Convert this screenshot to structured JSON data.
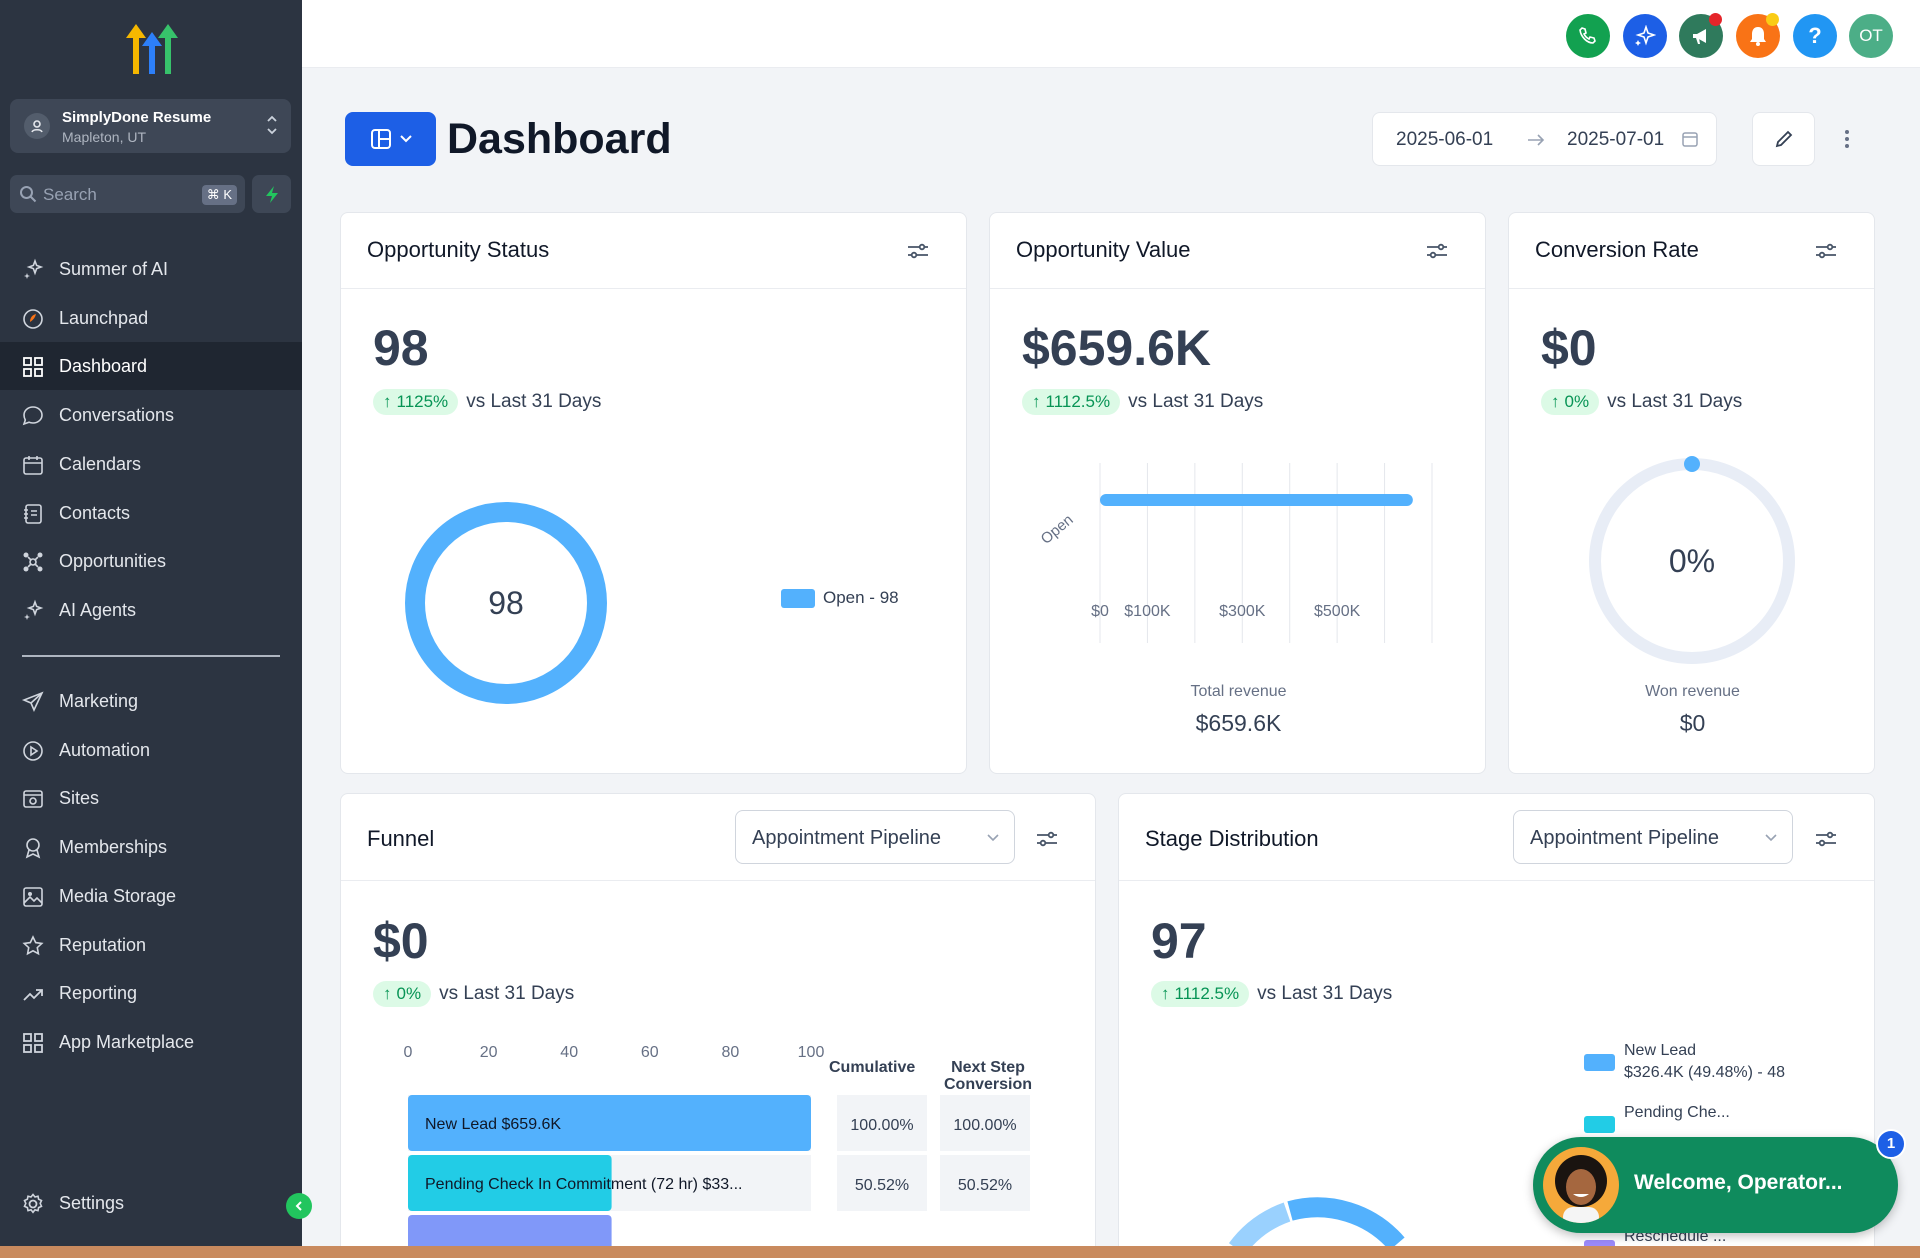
{
  "location": {
    "name": "SimplyDone Resume",
    "city": "Mapleton, UT"
  },
  "search": {
    "placeholder": "Search",
    "shortcut": "⌘ K"
  },
  "nav_top": [
    {
      "label": "Summer of AI",
      "icon": "sparkle-icon"
    },
    {
      "label": "Launchpad",
      "icon": "rocket-icon"
    },
    {
      "label": "Dashboard",
      "icon": "grid-icon",
      "active": true
    },
    {
      "label": "Conversations",
      "icon": "chat-bubble-icon"
    },
    {
      "label": "Calendars",
      "icon": "calendar-icon"
    },
    {
      "label": "Contacts",
      "icon": "contact-book-icon"
    },
    {
      "label": "Opportunities",
      "icon": "network-icon"
    },
    {
      "label": "AI Agents",
      "icon": "sparkle-icon"
    }
  ],
  "nav_bottom": [
    {
      "label": "Marketing",
      "icon": "send-icon"
    },
    {
      "label": "Automation",
      "icon": "play-circle-icon"
    },
    {
      "label": "Sites",
      "icon": "browser-icon"
    },
    {
      "label": "Memberships",
      "icon": "award-icon"
    },
    {
      "label": "Media Storage",
      "icon": "image-icon"
    },
    {
      "label": "Reputation",
      "icon": "star-icon"
    },
    {
      "label": "Reporting",
      "icon": "trend-up-icon"
    },
    {
      "label": "App Marketplace",
      "icon": "apps-icon"
    }
  ],
  "settings": {
    "label": "Settings"
  },
  "topbar": {
    "avatar_initials": "OT",
    "colors": {
      "phone": "#12a150",
      "ai": "#1d5fe6",
      "announce": "#2f7a5c",
      "bell": "#f97316",
      "help": "#2196f3",
      "avatar": "#4cae87"
    }
  },
  "header": {
    "title": "Dashboard",
    "date_start": "2025-06-01",
    "date_end": "2025-07-01"
  },
  "opportunity_status": {
    "title": "Opportunity Status",
    "value": "98",
    "change": "1125%",
    "vs": "vs Last 31 Days",
    "center": "98",
    "legend": "Open - 98"
  },
  "opportunity_value": {
    "title": "Opportunity Value",
    "value": "$659.6K",
    "change": "1112.5%",
    "vs": "vs Last 31 Days",
    "total_label": "Total revenue",
    "total_value": "$659.6K"
  },
  "conversion_rate": {
    "title": "Conversion Rate",
    "value": "$0",
    "change": "0%",
    "vs": "vs Last 31 Days",
    "center": "0%",
    "won_label": "Won revenue",
    "won_value": "$0"
  },
  "funnel": {
    "title": "Funnel",
    "pipeline": "Appointment Pipeline",
    "value": "$0",
    "change": "0%",
    "vs": "vs Last 31 Days",
    "col_cumulative": "Cumulative",
    "col_next": "Next Step Conversion"
  },
  "stage_distribution": {
    "title": "Stage Distribution",
    "pipeline": "Appointment Pipeline",
    "value": "97",
    "change": "1112.5%",
    "vs": "vs Last 31 Days"
  },
  "chat": {
    "text": "Welcome, Operator...",
    "badge": "1"
  },
  "chart_data": [
    {
      "type": "pie",
      "title": "Opportunity Status",
      "labels": [
        "Open"
      ],
      "values": [
        98
      ],
      "legend": [
        "Open - 98"
      ],
      "colors": [
        "#53b1fd"
      ]
    },
    {
      "type": "bar",
      "orientation": "horizontal",
      "title": "Opportunity Value",
      "categories": [
        "Open"
      ],
      "values": [
        659.6
      ],
      "value_unit": "$K",
      "xticks": [
        "$0",
        "$100K",
        "$300K",
        "$500K"
      ],
      "xlim": [
        0,
        700
      ],
      "color": "#53b1fd"
    },
    {
      "type": "pie",
      "title": "Conversion Rate",
      "values": [
        0
      ],
      "center_label": "0%"
    },
    {
      "type": "bar",
      "orientation": "horizontal",
      "title": "Funnel",
      "xticks": [
        "0",
        "20",
        "40",
        "60",
        "80",
        "100"
      ],
      "xlim": [
        0,
        100
      ],
      "categories": [
        "New Lead",
        "Pending Check In Commitment (72 hr)"
      ],
      "value_labels": [
        "$659.6K",
        "$33..."
      ],
      "values": [
        100.0,
        50.52
      ],
      "cumulative": [
        "100.00%",
        "50.52%"
      ],
      "next_step": [
        "100.00%",
        "50.52%"
      ],
      "colors": [
        "#53b1fd",
        "#22cce6"
      ]
    },
    {
      "type": "pie",
      "title": "Stage Distribution",
      "legend": [
        {
          "name": "New Lead",
          "detail": "$326.4K (49.48%) - 48",
          "color": "#53b1fd"
        },
        {
          "name": "Pending Che...",
          "color": "#22cce6"
        },
        {
          "name": "Reschedule ...",
          "color": "#9b8afb"
        }
      ]
    }
  ]
}
